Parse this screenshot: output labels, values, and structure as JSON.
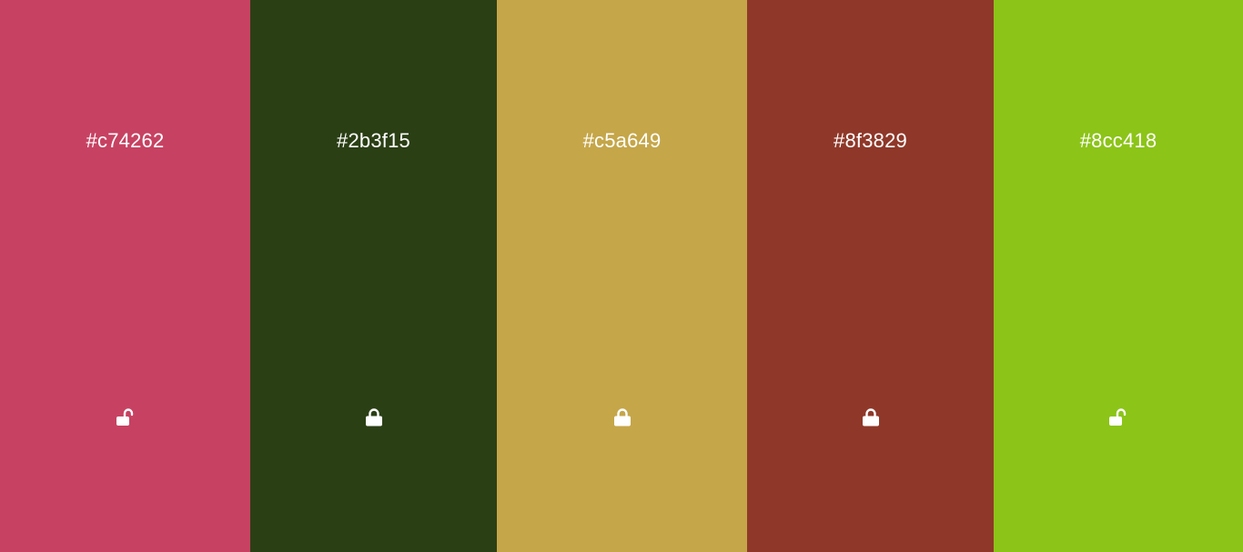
{
  "palette": {
    "swatches": [
      {
        "hex": "#c74262",
        "color": "#c74262",
        "locked": false,
        "lock_icon": "unlocked-icon"
      },
      {
        "hex": "#2b3f15",
        "color": "#2b3f15",
        "locked": true,
        "lock_icon": "locked-icon"
      },
      {
        "hex": "#c5a649",
        "color": "#c5a649",
        "locked": true,
        "lock_icon": "locked-icon"
      },
      {
        "hex": "#8f3829",
        "color": "#8f3829",
        "locked": true,
        "lock_icon": "locked-icon"
      },
      {
        "hex": "#8cc418",
        "color": "#8cc418",
        "locked": false,
        "lock_icon": "unlocked-icon"
      }
    ]
  }
}
